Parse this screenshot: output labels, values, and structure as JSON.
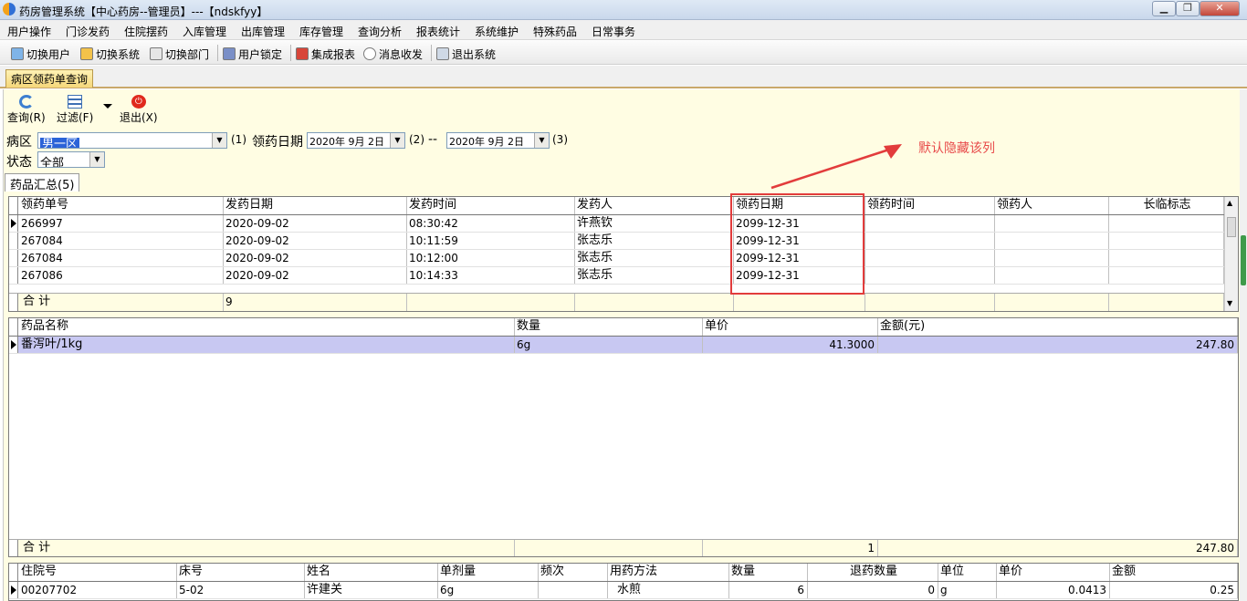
{
  "window": {
    "title": "药房管理系统【中心药房--管理员】---【ndskfyy】",
    "min_label": "▁",
    "max_label": "❐",
    "close_label": "✕"
  },
  "menu": [
    "用户操作",
    "门诊发药",
    "住院摆药",
    "入库管理",
    "出库管理",
    "库存管理",
    "查询分析",
    "报表统计",
    "系统维护",
    "特殊药品",
    "日常事务"
  ],
  "toolbar": [
    "切换用户",
    "切换系统",
    "切换部门",
    "用户锁定",
    "集成报表",
    "消息收发",
    "退出系统"
  ],
  "doc_tab": "病区领药单查询",
  "actions": {
    "query": "查询(R)",
    "filter": "过滤(F)",
    "exit": "退出(X)"
  },
  "filters": {
    "ward_label": "病区",
    "ward_value": "男一区",
    "ward_hotkey": "(1)",
    "date_label": "领药日期",
    "date_from": "2020年 9月 2日",
    "date_from_hotkey": "(2)",
    "date_sep": "--",
    "date_to": "2020年 9月 2日",
    "date_to_hotkey": "(3)",
    "status_label": "状态",
    "status_value": "全部"
  },
  "inner_tab": "药品汇总(5)",
  "annotation": "默认隐藏该列",
  "summary_table": {
    "columns": [
      "领药单号",
      "发药日期",
      "发药时间",
      "发药人",
      "领药日期",
      "领药时间",
      "领药人",
      "长临标志"
    ],
    "rows": [
      [
        "266997",
        "2020-09-02",
        "08:30:42",
        "许燕钦",
        "2099-12-31",
        "",
        "",
        ""
      ],
      [
        "267084",
        "2020-09-02",
        "10:11:59",
        "张志乐",
        "2099-12-31",
        "",
        "",
        ""
      ],
      [
        "267084",
        "2020-09-02",
        "10:12:00",
        "张志乐",
        "2099-12-31",
        "",
        "",
        ""
      ],
      [
        "267086",
        "2020-09-02",
        "10:14:33",
        "张志乐",
        "2099-12-31",
        "",
        "",
        ""
      ]
    ],
    "total_label": "合  计",
    "total_count": "9"
  },
  "drug_table": {
    "columns": [
      "药品名称",
      "数量",
      "单价",
      "金额(元)"
    ],
    "rows": [
      [
        "番泻叶/1kg",
        "6g",
        "41.3000",
        "247.80"
      ]
    ],
    "total_label": "合  计",
    "total_qty": "1",
    "total_amount": "247.80"
  },
  "patient_table": {
    "columns": [
      "住院号",
      "床号",
      "姓名",
      "单剂量",
      "频次",
      "用药方法",
      "数量",
      "退药数量",
      "单位",
      "单价",
      "金额"
    ],
    "rows": [
      [
        "00207702",
        "5-02",
        "许建关",
        "6g",
        "",
        "水煎",
        "6",
        "0",
        "g",
        "0.0413",
        "0.25"
      ]
    ]
  },
  "colors": {
    "accent_red": "#e23c3c",
    "selected_row": "#c8c8f2",
    "workspace": "#fffde3"
  }
}
